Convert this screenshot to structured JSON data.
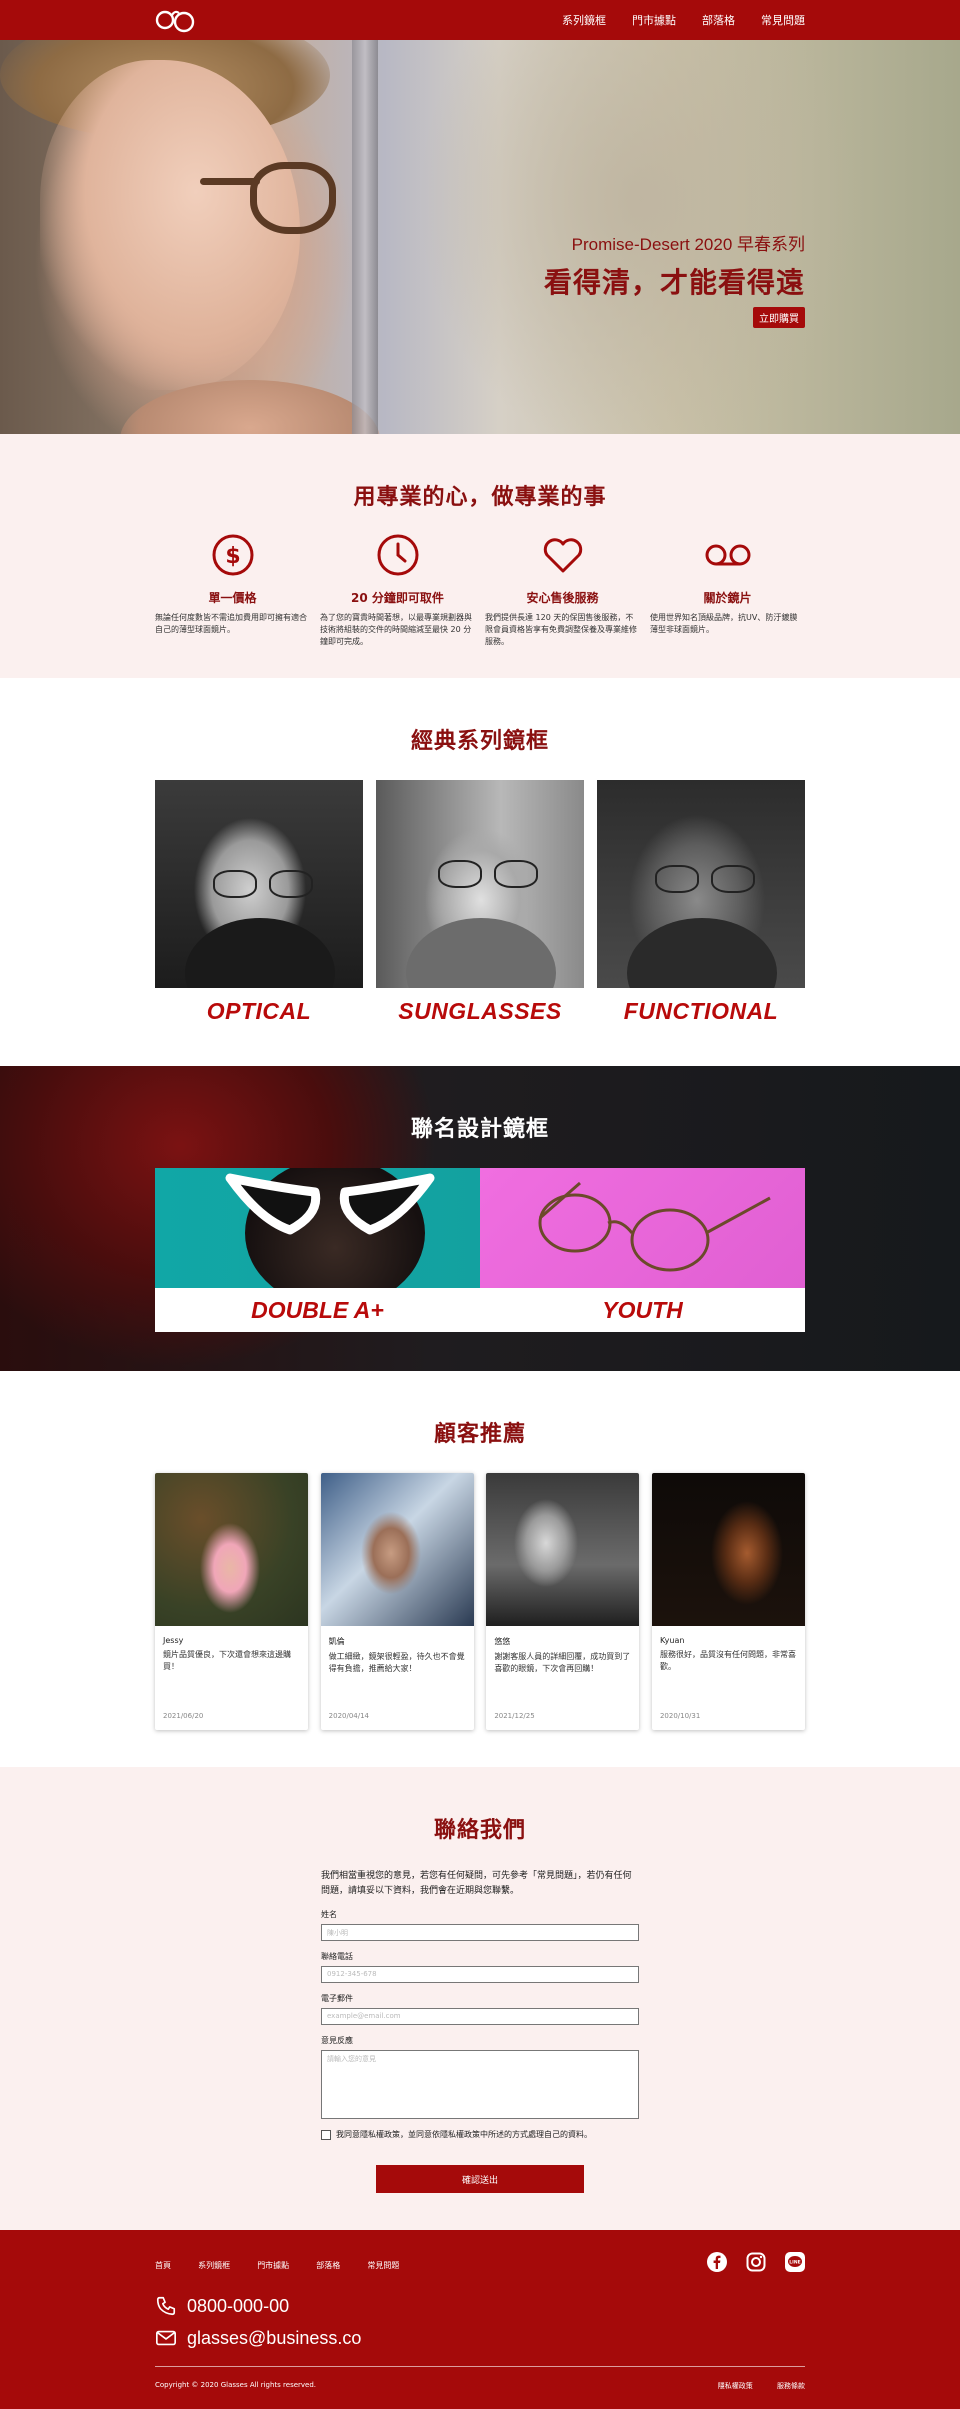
{
  "nav": {
    "items": [
      "系列鏡框",
      "門市據點",
      "部落格",
      "常見問題"
    ]
  },
  "hero": {
    "subtitle": "Promise-Desert 2020 早春系列",
    "title": "看得清，才能看得遠",
    "cta": "立即購買"
  },
  "services": {
    "title": "用專業的心，做專業的事",
    "items": [
      {
        "icon": "dollar-icon",
        "title": "單一價格",
        "text": "無論任何度數皆不需追加費用即可擁有適合自己的薄型球面鏡片。"
      },
      {
        "icon": "clock-icon",
        "title": "20 分鐘即可取件",
        "text": "為了您的寶貴時間著想，以最專業規劃器與技術將組裝的交件的時間縮減至最快 20 分鐘即可完成。"
      },
      {
        "icon": "heart-icon",
        "title": "安心售後服務",
        "text": "我們提供長達 120 天的保固售後服務，不限會員資格皆享有免費調整保養及專業維修服務。"
      },
      {
        "icon": "voicemail-icon",
        "title": "關於鏡片",
        "text": "使用世界知名頂級品牌，抗UV、防汙鍍膜薄型非球面鏡片。"
      }
    ]
  },
  "classic": {
    "title": "經典系列鏡框",
    "items": [
      "OPTICAL",
      "SUNGLASSES",
      "FUNCTIONAL"
    ]
  },
  "collab": {
    "title": "聯名設計鏡框",
    "items": [
      "DOUBLE A+",
      "YOUTH"
    ]
  },
  "testimonials": {
    "title": "顧客推薦",
    "items": [
      {
        "name": "Jessy",
        "text": "鏡片品質優良，下次還會想來這邊購買！",
        "date": "2021/06/20"
      },
      {
        "name": "凱倫",
        "text": "做工細緻，鏡架很輕盈，待久也不會覺得有負擔，推薦給大家！",
        "date": "2020/04/14"
      },
      {
        "name": "悠悠",
        "text": "謝謝客服人員的詳細回覆，成功買到了喜歡的眼鏡，下次會再回購！",
        "date": "2021/12/25"
      },
      {
        "name": "Kyuan",
        "text": "服務很好，品質沒有任何問題，非常喜歡。",
        "date": "2020/10/31"
      }
    ]
  },
  "contact": {
    "title": "聯絡我們",
    "intro": "我們相當重視您的意見，若您有任何疑問，可先參考「常見問題」，若仍有任何問題，請填妥以下資料，我們會在近期與您聯繫。",
    "fields": [
      {
        "label": "姓名",
        "placeholder": "陳小明"
      },
      {
        "label": "聯絡電話",
        "placeholder": "0912-345-678"
      },
      {
        "label": "電子郵件",
        "placeholder": "example@email.com"
      },
      {
        "label": "意見反應",
        "placeholder": "請輸入您的意見"
      }
    ],
    "agree": "我同意隱私權政策，並同意依隱私權政策中所述的方式處理自己的資料。",
    "submit": "確認送出"
  },
  "footer": {
    "links": [
      "首頁",
      "系列鏡框",
      "門市據點",
      "部落格",
      "常見問題"
    ],
    "social": [
      "facebook-icon",
      "instagram-icon",
      "line-icon"
    ],
    "phone": "0800-000-00",
    "email": "glasses@business.co",
    "copyright": "Copyright © 2020 Glasses All rights reserved.",
    "bottom_links": [
      "隱私權政策",
      "服務條款"
    ]
  },
  "colors": {
    "brand": "#a50a0a",
    "pale": "#fbf0ef"
  }
}
